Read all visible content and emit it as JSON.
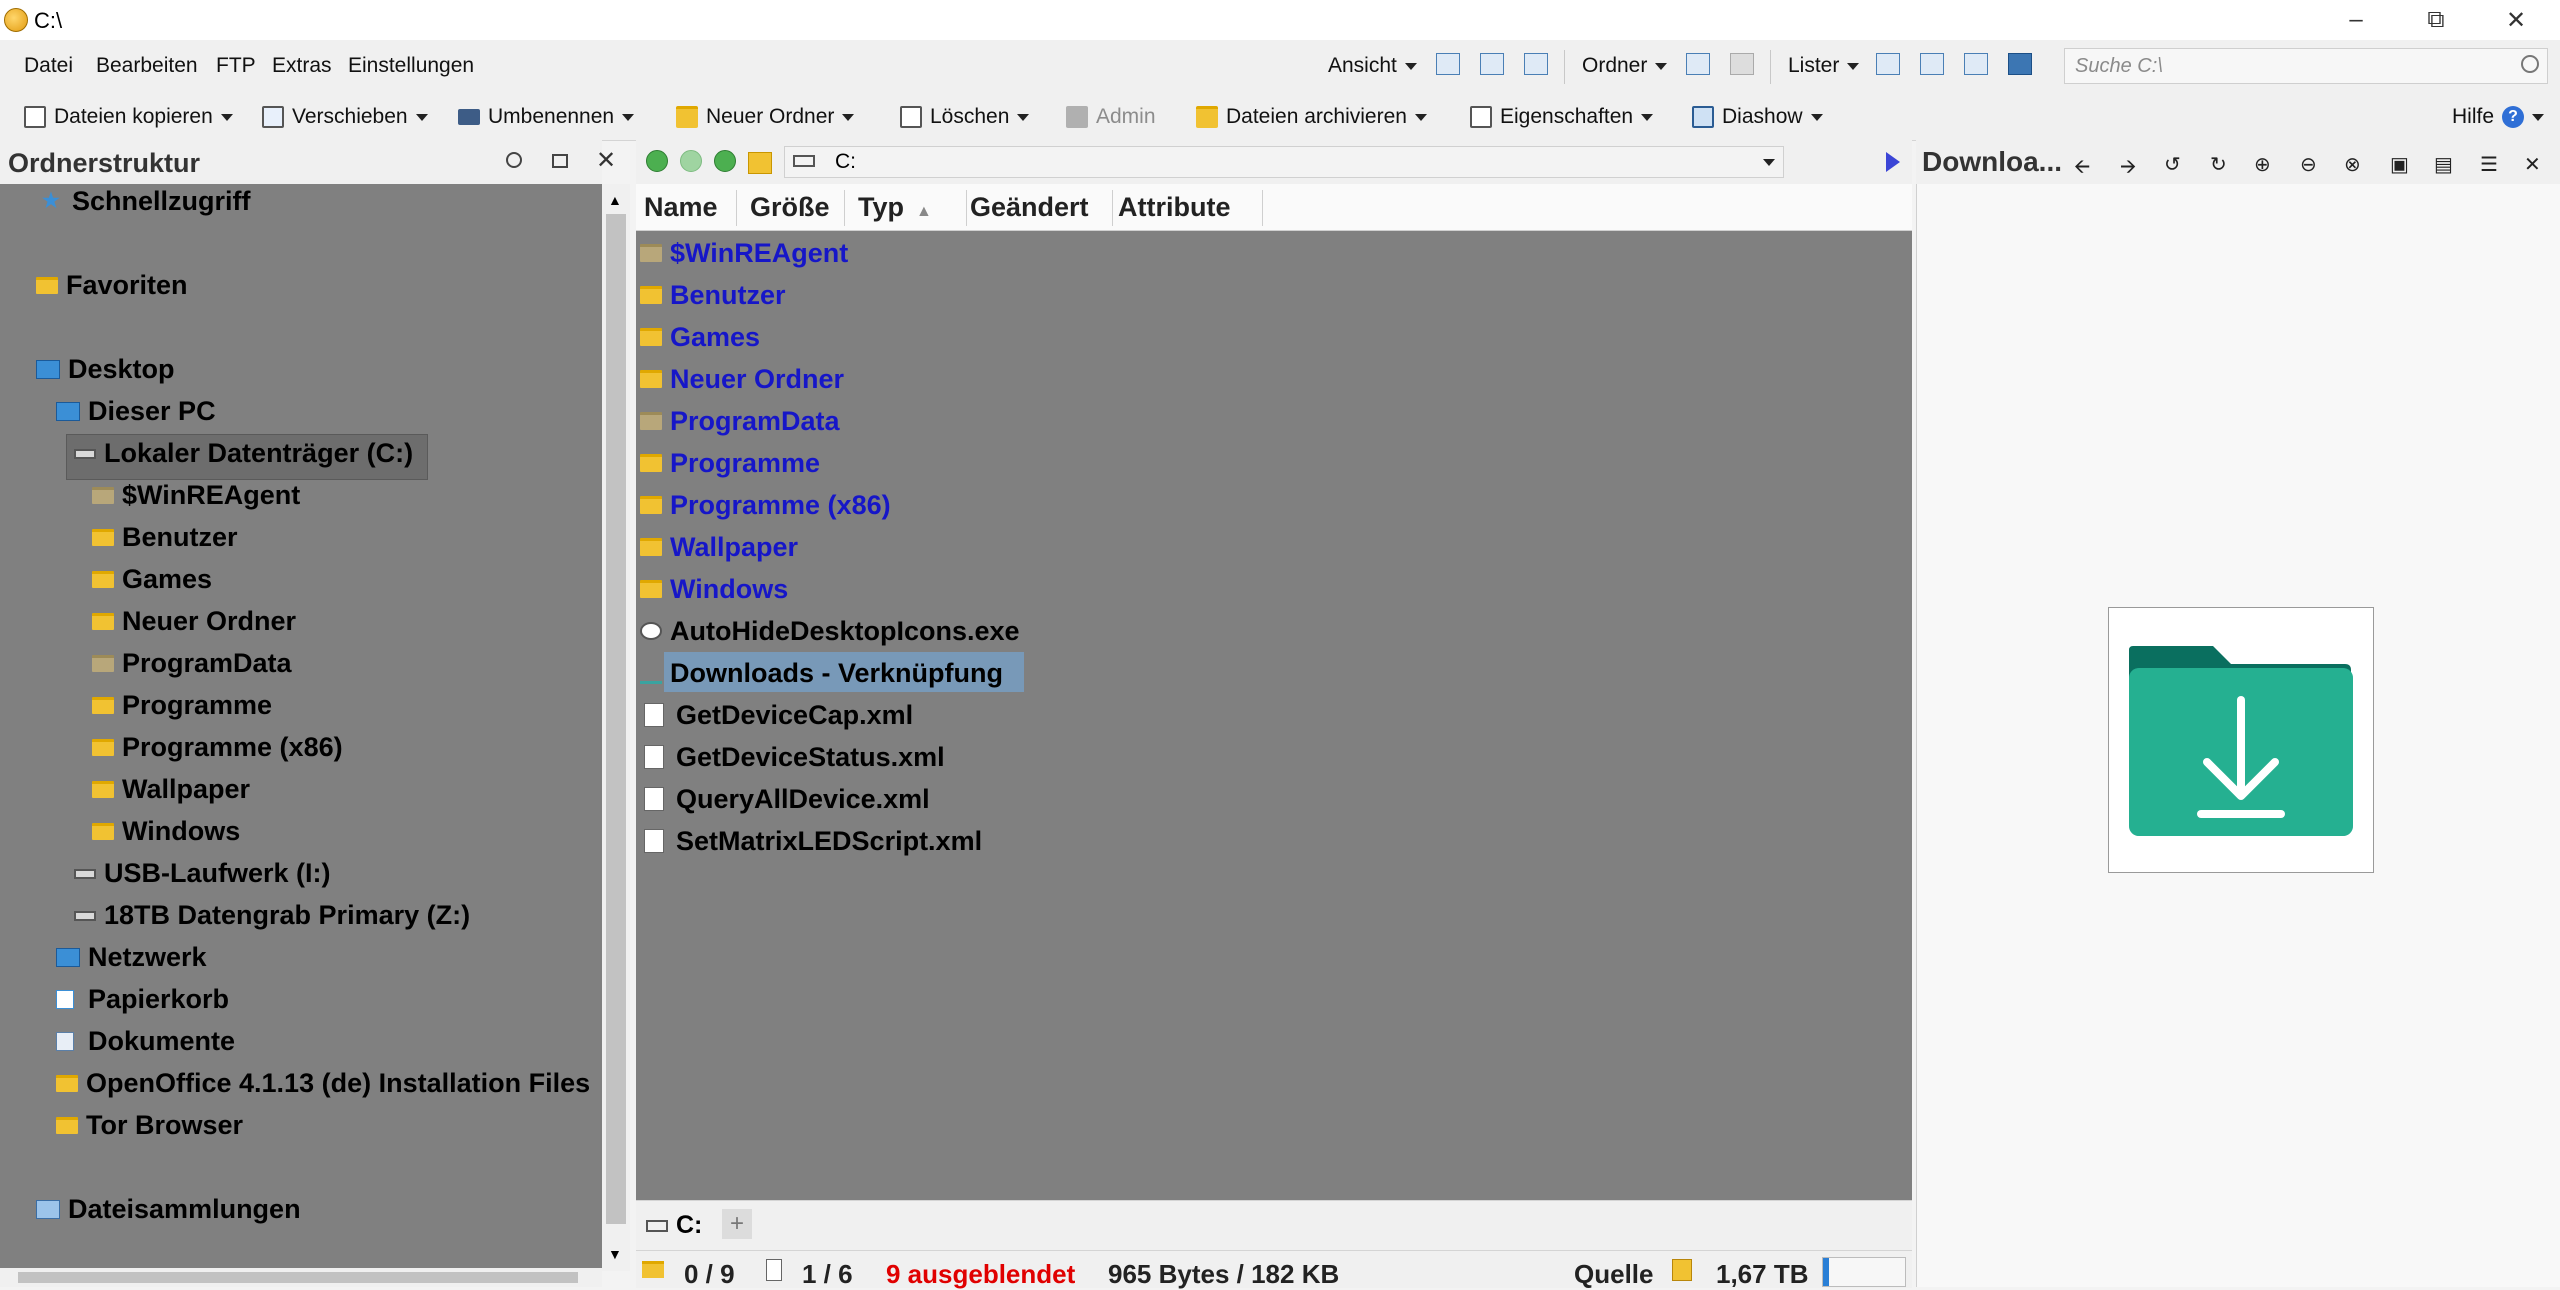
{
  "window": {
    "title": "C:\\",
    "controls": [
      "minimize",
      "restore",
      "close"
    ]
  },
  "menubar": {
    "items": [
      "Datei",
      "Bearbeiten",
      "FTP",
      "Extras",
      "Einstellungen"
    ],
    "view_label": "Ansicht",
    "folder_label": "Ordner",
    "lister_label": "Lister",
    "search_placeholder": "Suche C:\\"
  },
  "toolbar": {
    "copy": "Dateien kopieren",
    "move": "Verschieben",
    "rename": "Umbenennen",
    "new_folder": "Neuer Ordner",
    "delete": "Löschen",
    "admin": "Admin",
    "archive": "Dateien archivieren",
    "properties": "Eigenschaften",
    "slideshow": "Diashow",
    "help": "Hilfe"
  },
  "folder_tree": {
    "title": "Ordnerstruktur",
    "items": [
      {
        "label": "Schnellzugriff",
        "icon": "star-icon"
      },
      {
        "label": "Favoriten",
        "icon": "folder-icon"
      },
      {
        "label": "Desktop",
        "icon": "desktop-icon"
      },
      {
        "label": "Dieser PC",
        "icon": "pc-icon"
      },
      {
        "label": "Lokaler Datenträger (C:)",
        "icon": "drive-icon"
      },
      {
        "label": "$WinREAgent",
        "icon": "folder-icon"
      },
      {
        "label": "Benutzer",
        "icon": "folder-icon"
      },
      {
        "label": "Games",
        "icon": "folder-icon"
      },
      {
        "label": "Neuer Ordner",
        "icon": "folder-icon"
      },
      {
        "label": "ProgramData",
        "icon": "folder-icon"
      },
      {
        "label": "Programme",
        "icon": "folder-icon"
      },
      {
        "label": "Programme (x86)",
        "icon": "folder-icon"
      },
      {
        "label": "Wallpaper",
        "icon": "folder-icon"
      },
      {
        "label": "Windows",
        "icon": "folder-icon"
      },
      {
        "label": "USB-Laufwerk (I:)",
        "icon": "drive-icon"
      },
      {
        "label": "18TB Datengrab Primary (Z:)",
        "icon": "drive-icon"
      },
      {
        "label": "Netzwerk",
        "icon": "network-icon"
      },
      {
        "label": "Papierkorb",
        "icon": "recycle-bin-icon"
      },
      {
        "label": "Dokumente",
        "icon": "documents-icon"
      },
      {
        "label": "OpenOffice 4.1.13 (de) Installation Files",
        "icon": "folder-icon"
      },
      {
        "label": "Tor Browser",
        "icon": "folder-icon"
      },
      {
        "label": "Dateisammlungen",
        "icon": "collections-icon"
      }
    ]
  },
  "address": {
    "path": "C:"
  },
  "columns": [
    "Name",
    "Größe",
    "Typ",
    "Geändert",
    "Attribute"
  ],
  "files": [
    {
      "name": "$WinREAgent",
      "kind": "dir"
    },
    {
      "name": "Benutzer",
      "kind": "dir"
    },
    {
      "name": "Games",
      "kind": "dir"
    },
    {
      "name": "Neuer Ordner",
      "kind": "dir"
    },
    {
      "name": "ProgramData",
      "kind": "dir"
    },
    {
      "name": "Programme",
      "kind": "dir"
    },
    {
      "name": "Programme (x86)",
      "kind": "dir"
    },
    {
      "name": "Wallpaper",
      "kind": "dir"
    },
    {
      "name": "Windows",
      "kind": "dir"
    },
    {
      "name": "AutoHideDesktopIcons.exe",
      "kind": "exe"
    },
    {
      "name": "Downloads - Verknüpfung",
      "kind": "lnk"
    },
    {
      "name": "GetDeviceCap.xml",
      "kind": "file"
    },
    {
      "name": "GetDeviceStatus.xml",
      "kind": "file"
    },
    {
      "name": "QueryAllDevice.xml",
      "kind": "file"
    },
    {
      "name": "SetMatrixLEDScript.xml",
      "kind": "file"
    }
  ],
  "tab": {
    "label": "C:",
    "add": "+"
  },
  "status": {
    "folders": "0 / 9",
    "files": "1 / 6",
    "hidden": "9 ausgeblendet",
    "size": "965 Bytes / 182 KB",
    "source": "Quelle",
    "free": "1,67 TB"
  },
  "preview": {
    "title": "Downloa..."
  },
  "colors": {
    "dir_text": "#1616c8",
    "hidden_text": "#e00000",
    "pane_bg": "#808080",
    "preview_icon": "#1aa79a"
  }
}
